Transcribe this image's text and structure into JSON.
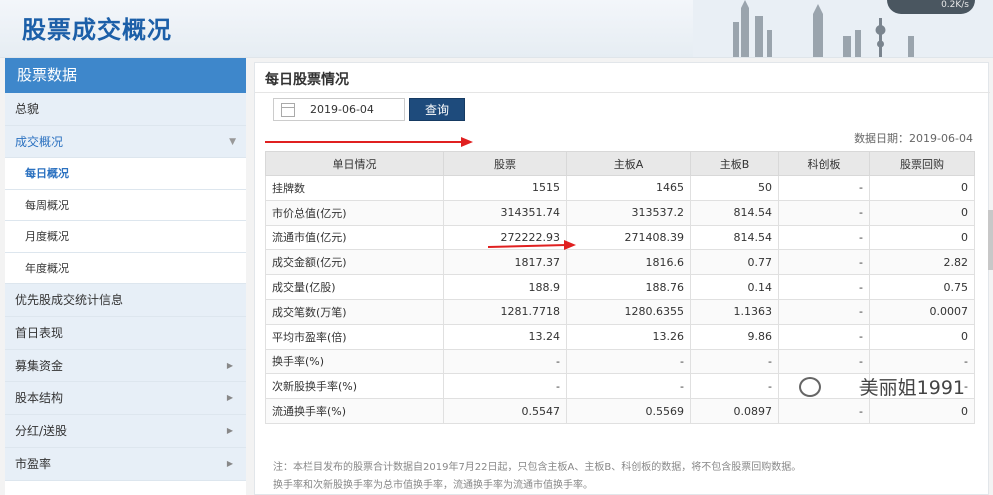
{
  "header": {
    "title": "股票成交概况",
    "widget_text": "0.2K/s"
  },
  "sidebar": {
    "head": "股票数据",
    "items": [
      {
        "label": "总貌"
      },
      {
        "label": "成交概况"
      },
      {
        "label": "每日概况"
      },
      {
        "label": "每周概况"
      },
      {
        "label": "月度概况"
      },
      {
        "label": "年度概况"
      },
      {
        "label": "优先股成交统计信息"
      },
      {
        "label": "首日表现"
      },
      {
        "label": "募集资金"
      },
      {
        "label": "股本结构"
      },
      {
        "label": "分红/送股"
      },
      {
        "label": "市盈率"
      }
    ]
  },
  "main": {
    "title": "每日股票情况",
    "date_value": "2019-06-04",
    "query_label": "查询",
    "data_date": "数据日期：2019-06-04",
    "table": {
      "headers": [
        "单日情况",
        "股票",
        "主板A",
        "主板B",
        "科创板",
        "股票回购"
      ],
      "rows": [
        [
          "挂牌数",
          "1515",
          "1465",
          "50",
          "-",
          "0"
        ],
        [
          "市价总值(亿元)",
          "314351.74",
          "313537.2",
          "814.54",
          "-",
          "0"
        ],
        [
          "流通市值(亿元)",
          "272222.93",
          "271408.39",
          "814.54",
          "-",
          "0"
        ],
        [
          "成交金额(亿元)",
          "1817.37",
          "1816.6",
          "0.77",
          "-",
          "2.82"
        ],
        [
          "成交量(亿股)",
          "188.9",
          "188.76",
          "0.14",
          "-",
          "0.75"
        ],
        [
          "成交笔数(万笔)",
          "1281.7718",
          "1280.6355",
          "1.1363",
          "-",
          "0.0007"
        ],
        [
          "平均市盈率(倍)",
          "13.24",
          "13.26",
          "9.86",
          "-",
          "0"
        ],
        [
          "换手率(%)",
          "-",
          "-",
          "-",
          "-",
          "-"
        ],
        [
          "次新股换手率(%)",
          "-",
          "-",
          "-",
          "-",
          "-"
        ],
        [
          "流通换手率(%)",
          "0.5547",
          "0.5569",
          "0.0897",
          "-",
          "0"
        ]
      ]
    },
    "note_line1": "注：本栏目发布的股票合计数据自2019年7月22日起，只包含主板A、主板B、科创板的数据，将不包含股票回购数据。",
    "note_line2": "换手率和次新股换手率为总市值换手率，流通换手率为流通市值换手率。"
  },
  "watermark": "美丽姐1991",
  "colors": {
    "accent": "#3e87cb",
    "title_blue": "#1c5fa8",
    "button": "#1e4b7c",
    "arrow": "#e02020"
  }
}
